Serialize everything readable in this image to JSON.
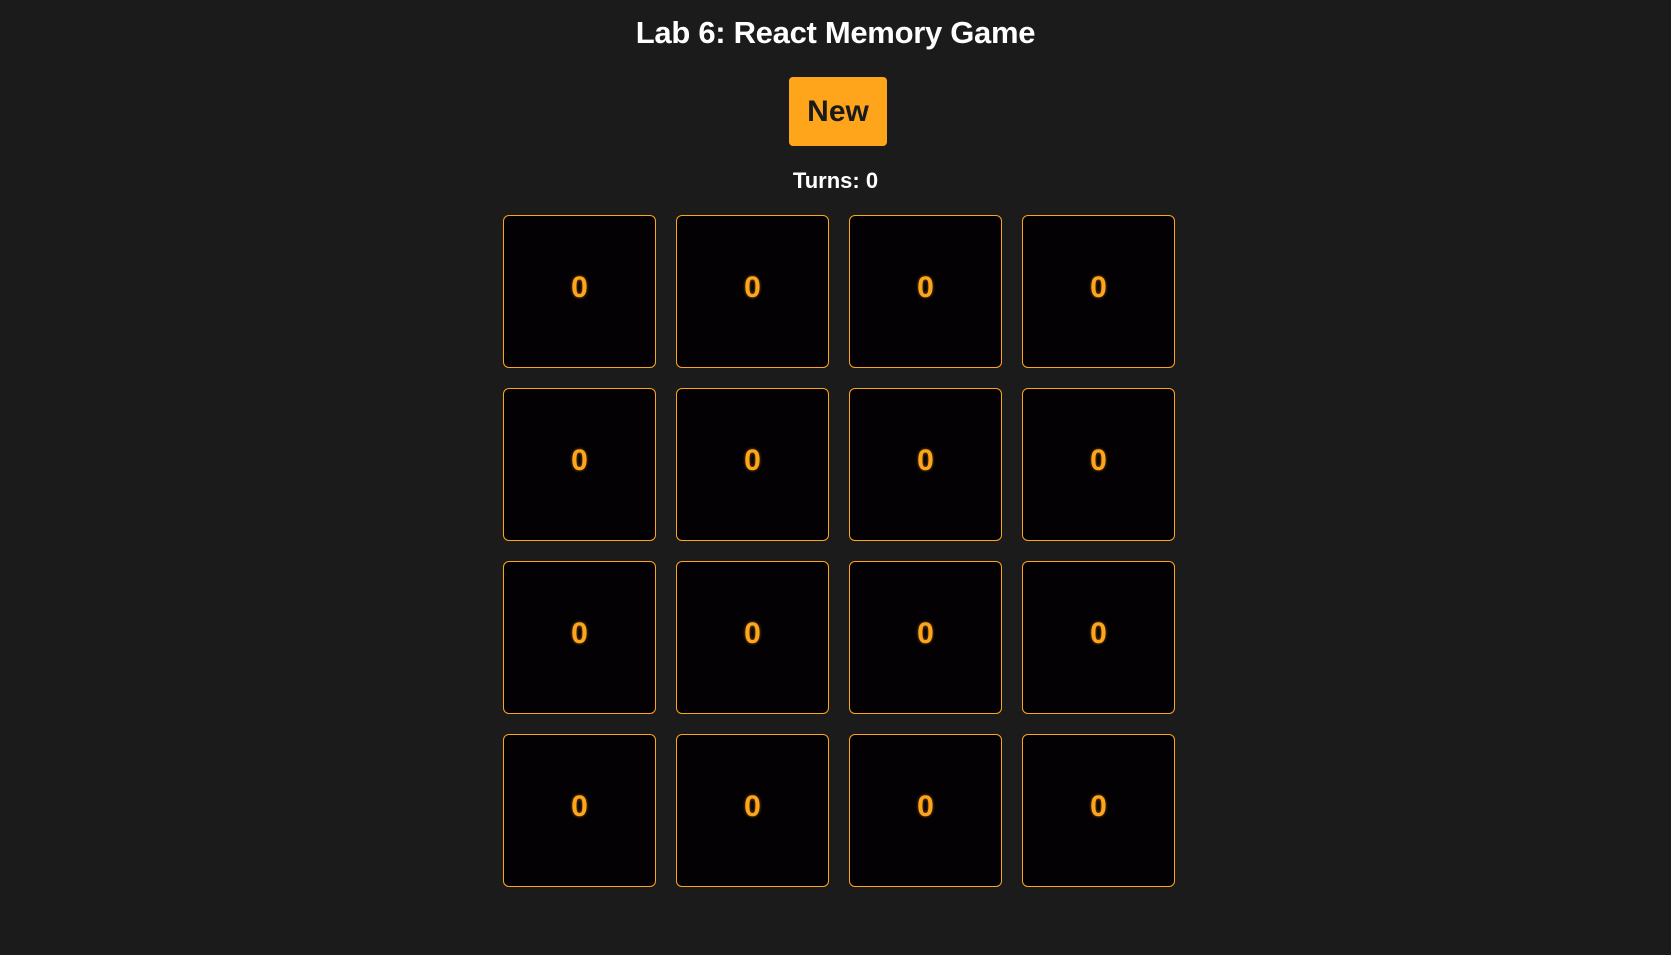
{
  "page": {
    "title": "Lab 6: React Memory Game"
  },
  "controls": {
    "new_button_label": "New",
    "turns_text": "Turns: 0"
  },
  "colors": {
    "background": "#1b1b1b",
    "accent": "#ffa51c",
    "card_face": "#030103"
  },
  "cards": [
    {
      "glyph": "0"
    },
    {
      "glyph": "0"
    },
    {
      "glyph": "0"
    },
    {
      "glyph": "0"
    },
    {
      "glyph": "0"
    },
    {
      "glyph": "0"
    },
    {
      "glyph": "0"
    },
    {
      "glyph": "0"
    },
    {
      "glyph": "0"
    },
    {
      "glyph": "0"
    },
    {
      "glyph": "0"
    },
    {
      "glyph": "0"
    },
    {
      "glyph": "0"
    },
    {
      "glyph": "0"
    },
    {
      "glyph": "0"
    },
    {
      "glyph": "0"
    }
  ]
}
